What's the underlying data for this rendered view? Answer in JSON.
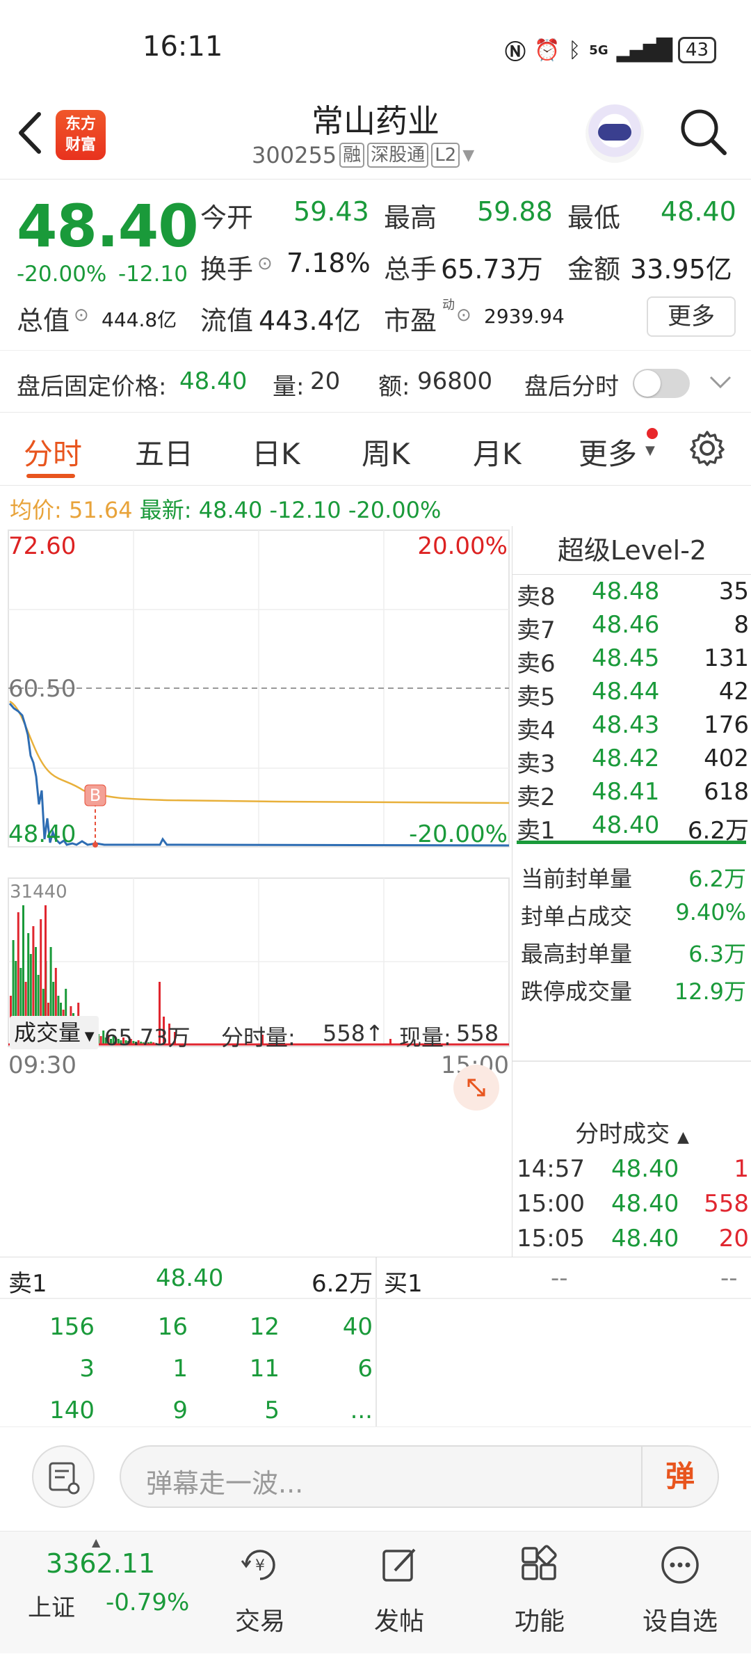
{
  "status": {
    "time": "16:11",
    "battery": "43",
    "net": "5G"
  },
  "header": {
    "title": "常山药业",
    "code": "300255",
    "tags": [
      "融",
      "深股通",
      "L2"
    ],
    "logo_top": "东方",
    "logo_bottom": "财富"
  },
  "quote": {
    "price": "48.40",
    "change_pct": "-20.00%",
    "change": "-12.10",
    "open_label": "今开",
    "open": "59.43",
    "high_label": "最高",
    "high": "59.88",
    "low_label": "最低",
    "low": "48.40",
    "turnover_label": "换手",
    "turnover": "7.18%",
    "vol_label": "总手",
    "vol": "65.73万",
    "amount_label": "金额",
    "amount": "33.95亿",
    "mktcap_label": "总值",
    "mktcap": "444.8亿",
    "float_label": "流值",
    "float": "443.4亿",
    "pe_label": "市盈",
    "pe_sup": "动",
    "pe": "2939.94",
    "more": "更多"
  },
  "afterhours": {
    "price_label": "盘后固定价格:",
    "price": "48.40",
    "vol_label": "量:",
    "vol": "20",
    "amt_label": "额:",
    "amt": "96800",
    "tick_label": "盘后分时"
  },
  "tabs": [
    "分时",
    "五日",
    "日K",
    "周K",
    "月K",
    "更多"
  ],
  "avgline": {
    "avg_label": "均价:",
    "avg": "51.64",
    "last_label": "最新:",
    "last": "48.40",
    "chg": "-12.10",
    "pct": "-20.00%"
  },
  "chart": {
    "y_top": "72.60",
    "y_mid": "60.50",
    "y_bot": "48.40",
    "pct_top": "20.00%",
    "pct_bot": "-20.00%",
    "marker": "B",
    "vol_label": "成交量",
    "vol_total": "65.73万",
    "tick_vol_label": "分时量:",
    "tick_vol": "558↑",
    "cur_label": "现量:",
    "cur": "558",
    "vol_max": "31440",
    "t_start": "09:30",
    "t_end": "15:00"
  },
  "chart_data": {
    "type": "line",
    "x_range": [
      "09:30",
      "15:00"
    ],
    "ylim": [
      48.4,
      72.6
    ],
    "series": [],
    "volume_max": 31440
  },
  "orderbook": {
    "title": "超级Level-2",
    "asks": [
      {
        "label": "卖8",
        "price": "48.48",
        "qty": "35"
      },
      {
        "label": "卖7",
        "price": "48.46",
        "qty": "8"
      },
      {
        "label": "卖6",
        "price": "48.45",
        "qty": "131"
      },
      {
        "label": "卖5",
        "price": "48.44",
        "qty": "42"
      },
      {
        "label": "卖4",
        "price": "48.43",
        "qty": "176"
      },
      {
        "label": "卖3",
        "price": "48.42",
        "qty": "402"
      },
      {
        "label": "卖2",
        "price": "48.41",
        "qty": "618"
      },
      {
        "label": "卖1",
        "price": "48.40",
        "qty": "6.2万"
      }
    ],
    "stats": [
      {
        "label": "当前封单量",
        "value": "6.2万"
      },
      {
        "label": "封单占成交",
        "value": "9.40%"
      },
      {
        "label": "最高封单量",
        "value": "6.3万"
      },
      {
        "label": "跌停成交量",
        "value": "12.9万"
      }
    ],
    "trades_title": "分时成交",
    "trades": [
      {
        "t": "14:57",
        "p": "48.40",
        "q": "1"
      },
      {
        "t": "15:00",
        "p": "48.40",
        "q": "558"
      },
      {
        "t": "15:05",
        "p": "48.40",
        "q": "20"
      }
    ]
  },
  "queue": {
    "sell_label": "卖1",
    "sell_price": "48.40",
    "sell_qty": "6.2万",
    "buy_label": "买1",
    "buy_price": "--",
    "buy_qty": "--",
    "rows": [
      [
        "156",
        "16",
        "12",
        "40"
      ],
      [
        "3",
        "1",
        "11",
        "6"
      ],
      [
        "140",
        "9",
        "5",
        "..."
      ]
    ]
  },
  "danmu": {
    "placeholder": "弹幕走一波...",
    "btn": "弹"
  },
  "nav": {
    "index_value": "3362.11",
    "index_name": "上证",
    "index_pct": "-0.79%",
    "items": [
      "交易",
      "发帖",
      "功能",
      "设自选"
    ]
  }
}
